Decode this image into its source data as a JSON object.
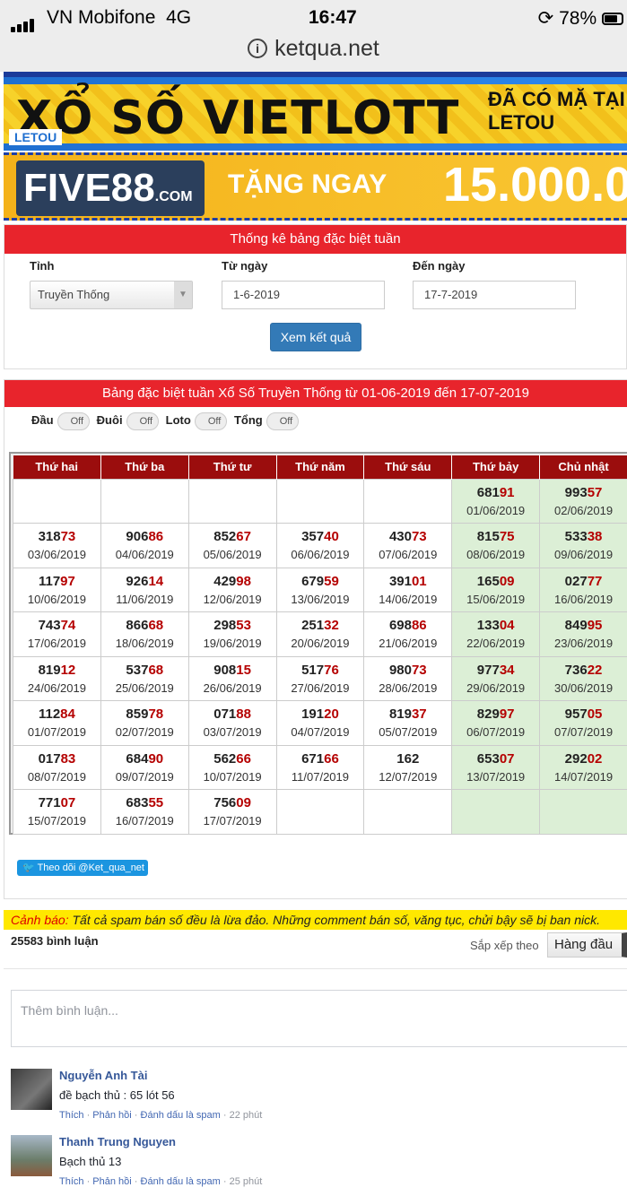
{
  "status_bar": {
    "carrier": "VN Mobifone",
    "network": "4G",
    "time": "16:47",
    "battery": "78%"
  },
  "browser": {
    "url": "ketqua.net"
  },
  "banners": {
    "vietlott_text": "XỔ SỐ VIETLOTT",
    "vietlott_side": "ĐÃ CÓ MẶ TẠI LETOU",
    "letou_logo": "LETOU",
    "five88_logo": "FIVE88",
    "five88_suffix": ".COM",
    "five88_promo": "TẶNG NGAY",
    "five88_amount": "15.000.0"
  },
  "filter": {
    "title": "Thống kê bảng đặc biệt tuần",
    "province_label": "Tỉnh",
    "province_value": "Truyền Thống",
    "from_label": "Từ ngày",
    "from_value": "1-6-2019",
    "to_label": "Đến ngày",
    "to_value": "17-7-2019",
    "submit_label": "Xem kết quả"
  },
  "table_section": {
    "title": "Bảng đặc biệt tuần Xổ Số Truyền Thống từ 01-06-2019 đến 17-07-2019",
    "toggles": [
      {
        "label": "Đầu",
        "state": "Off"
      },
      {
        "label": "Đuôi",
        "state": "Off"
      },
      {
        "label": "Loto",
        "state": "Off"
      },
      {
        "label": "Tổng",
        "state": "Off"
      }
    ],
    "headers": [
      "Thứ hai",
      "Thứ ba",
      "Thứ tư",
      "Thứ năm",
      "Thứ sáu",
      "Thứ bảy",
      "Chủ nhật"
    ],
    "rows": [
      [
        null,
        null,
        null,
        null,
        null,
        {
          "n": "681",
          "t": "91",
          "d": "01/06/2019"
        },
        {
          "n": "993",
          "t": "57",
          "d": "02/06/2019"
        }
      ],
      [
        {
          "n": "318",
          "t": "73",
          "d": "03/06/2019"
        },
        {
          "n": "906",
          "t": "86",
          "d": "04/06/2019"
        },
        {
          "n": "852",
          "t": "67",
          "d": "05/06/2019"
        },
        {
          "n": "357",
          "t": "40",
          "d": "06/06/2019"
        },
        {
          "n": "430",
          "t": "73",
          "d": "07/06/2019"
        },
        {
          "n": "815",
          "t": "75",
          "d": "08/06/2019"
        },
        {
          "n": "533",
          "t": "38",
          "d": "09/06/2019"
        }
      ],
      [
        {
          "n": "117",
          "t": "97",
          "d": "10/06/2019"
        },
        {
          "n": "926",
          "t": "14",
          "d": "11/06/2019"
        },
        {
          "n": "429",
          "t": "98",
          "d": "12/06/2019"
        },
        {
          "n": "679",
          "t": "59",
          "d": "13/06/2019"
        },
        {
          "n": "391",
          "t": "01",
          "d": "14/06/2019"
        },
        {
          "n": "165",
          "t": "09",
          "d": "15/06/2019"
        },
        {
          "n": "027",
          "t": "77",
          "d": "16/06/2019"
        }
      ],
      [
        {
          "n": "743",
          "t": "74",
          "d": "17/06/2019"
        },
        {
          "n": "866",
          "t": "68",
          "d": "18/06/2019"
        },
        {
          "n": "298",
          "t": "53",
          "d": "19/06/2019"
        },
        {
          "n": "251",
          "t": "32",
          "d": "20/06/2019"
        },
        {
          "n": "698",
          "t": "86",
          "d": "21/06/2019"
        },
        {
          "n": "133",
          "t": "04",
          "d": "22/06/2019"
        },
        {
          "n": "849",
          "t": "95",
          "d": "23/06/2019"
        }
      ],
      [
        {
          "n": "819",
          "t": "12",
          "d": "24/06/2019"
        },
        {
          "n": "537",
          "t": "68",
          "d": "25/06/2019"
        },
        {
          "n": "908",
          "t": "15",
          "d": "26/06/2019"
        },
        {
          "n": "517",
          "t": "76",
          "d": "27/06/2019"
        },
        {
          "n": "980",
          "t": "73",
          "d": "28/06/2019"
        },
        {
          "n": "977",
          "t": "34",
          "d": "29/06/2019"
        },
        {
          "n": "736",
          "t": "22",
          "d": "30/06/2019"
        }
      ],
      [
        {
          "n": "112",
          "t": "84",
          "d": "01/07/2019"
        },
        {
          "n": "859",
          "t": "78",
          "d": "02/07/2019"
        },
        {
          "n": "071",
          "t": "88",
          "d": "03/07/2019"
        },
        {
          "n": "191",
          "t": "20",
          "d": "04/07/2019"
        },
        {
          "n": "819",
          "t": "37",
          "d": "05/07/2019"
        },
        {
          "n": "829",
          "t": "97",
          "d": "06/07/2019"
        },
        {
          "n": "957",
          "t": "05",
          "d": "07/07/2019"
        }
      ],
      [
        {
          "n": "017",
          "t": "83",
          "d": "08/07/2019"
        },
        {
          "n": "684",
          "t": "90",
          "d": "09/07/2019"
        },
        {
          "n": "562",
          "t": "66",
          "d": "10/07/2019"
        },
        {
          "n": "671",
          "t": "66",
          "d": "11/07/2019"
        },
        {
          "n": "162",
          "t": "",
          "d": "12/07/2019"
        },
        {
          "n": "653",
          "t": "07",
          "d": "13/07/2019"
        },
        {
          "n": "292",
          "t": "02",
          "d": "14/07/2019"
        }
      ],
      [
        {
          "n": "771",
          "t": "07",
          "d": "15/07/2019"
        },
        {
          "n": "683",
          "t": "55",
          "d": "16/07/2019"
        },
        {
          "n": "756",
          "t": "09",
          "d": "17/07/2019"
        },
        null,
        null,
        null,
        null
      ]
    ],
    "twitter_label": "Theo dõi @Ket_qua_net"
  },
  "comments": {
    "warning_prefix": "Cảnh báo:",
    "warning_text": " Tất cả spam bán số đều là lừa đảo. Những comment bán số, văng tục, chửi bậy sẽ bị ban nick.",
    "count_label": "25583 bình luận",
    "sort_label": "Sắp xếp theo",
    "sort_value": "Hàng đầu",
    "input_placeholder": "Thêm bình luận...",
    "items": [
      {
        "name": "Nguyễn Anh Tài",
        "text": "đề bạch thủ : 65 lót 56",
        "like": "Thích",
        "reply": "Phản hồi",
        "spam": "Đánh dấu là spam",
        "time": "22 phút"
      },
      {
        "name": "Thanh Trung Nguyen",
        "text": "Bạch thủ 13",
        "like": "Thích",
        "reply": "Phản hồi",
        "spam": "Đánh dấu là spam",
        "time": "25 phút"
      }
    ]
  },
  "colors": {
    "header_red": "#e8242c",
    "table_header": "#9b0d0d",
    "tail_red": "#b50000",
    "weekend_green": "#dcefd6",
    "button_blue": "#337ab7"
  }
}
